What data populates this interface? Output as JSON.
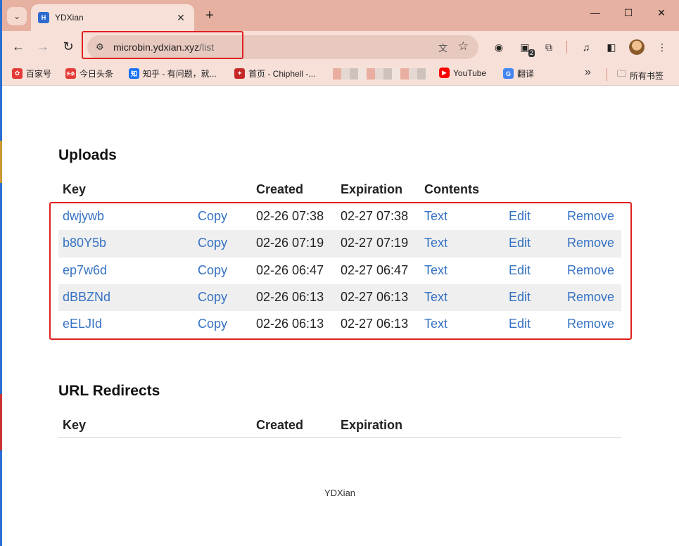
{
  "browser": {
    "tab_title": "YDXian",
    "tab_favicon": "H",
    "url_host": "microbin.ydxian.xyz",
    "url_path": "/list"
  },
  "bookmarks": [
    {
      "label": "百家号",
      "icon": "baijiahao-icon",
      "color": "#e53935"
    },
    {
      "label": "今日头条",
      "icon": "toutiao-icon",
      "color": "#e53935",
      "glyph": "头条"
    },
    {
      "label": "知乎 - 有问题，就...",
      "icon": "zhihu-icon",
      "color": "#1772f6",
      "glyph": "知"
    },
    {
      "label": "首页 - Chiphell -...",
      "icon": "chiphell-icon",
      "color": "#c62828"
    },
    {
      "label": "YouTube",
      "icon": "youtube-icon",
      "color": "#ff0000"
    },
    {
      "label": "翻译",
      "icon": "translate-icon",
      "color": "#4285f4"
    }
  ],
  "all_bookmarks_label": "所有书签",
  "extension_badge": "2",
  "uploads": {
    "title": "Uploads",
    "headers": {
      "key": "Key",
      "created": "Created",
      "expiration": "Expiration",
      "contents": "Contents"
    },
    "rows": [
      {
        "key": "dwjywb",
        "copy": "Copy",
        "created": "02-26 07:38",
        "expiration": "02-27 07:38",
        "contents": "Text",
        "edit": "Edit",
        "remove": "Remove"
      },
      {
        "key": "b80Y5b",
        "copy": "Copy",
        "created": "02-26 07:19",
        "expiration": "02-27 07:19",
        "contents": "Text",
        "edit": "Edit",
        "remove": "Remove"
      },
      {
        "key": "ep7w6d",
        "copy": "Copy",
        "created": "02-26 06:47",
        "expiration": "02-27 06:47",
        "contents": "Text",
        "edit": "Edit",
        "remove": "Remove"
      },
      {
        "key": "dBBZNd",
        "copy": "Copy",
        "created": "02-26 06:13",
        "expiration": "02-27 06:13",
        "contents": "Text",
        "edit": "Edit",
        "remove": "Remove"
      },
      {
        "key": "eELJId",
        "copy": "Copy",
        "created": "02-26 06:13",
        "expiration": "02-27 06:13",
        "contents": "Text",
        "edit": "Edit",
        "remove": "Remove"
      }
    ]
  },
  "redirects": {
    "title": "URL Redirects",
    "headers": {
      "key": "Key",
      "created": "Created",
      "expiration": "Expiration"
    }
  },
  "footer": "YDXian",
  "colors": {
    "link": "#3572c4",
    "highlight": "#e02020",
    "chrome": "#f7e0d8"
  }
}
